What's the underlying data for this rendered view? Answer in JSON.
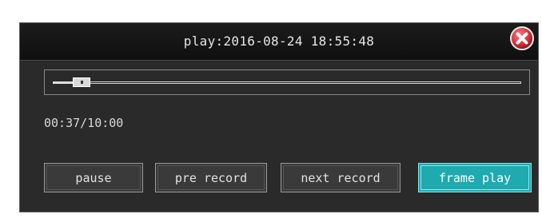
{
  "window": {
    "title": "play:2016-08-24 18:55:48",
    "close_icon": "close-icon"
  },
  "playback": {
    "time_text": "00:37/10:00",
    "progress_fraction": 0.0617
  },
  "buttons": {
    "pause": "pause",
    "pre_record": "pre record",
    "next_record": "next record",
    "frame_play": "frame play"
  },
  "colors": {
    "accent": "#1faab0",
    "close": "#d9363e"
  }
}
